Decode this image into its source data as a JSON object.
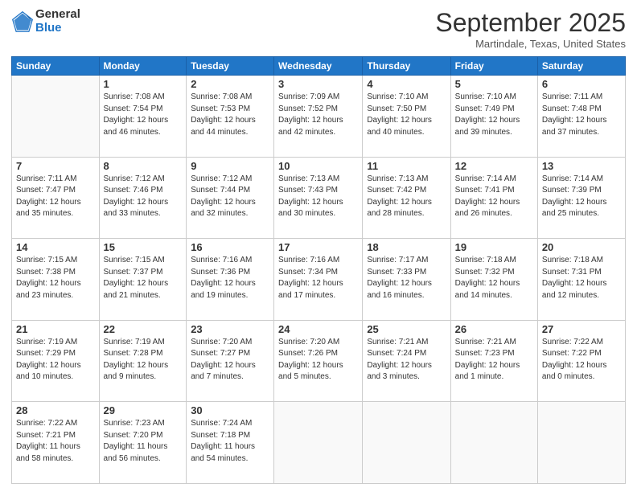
{
  "header": {
    "logo_general": "General",
    "logo_blue": "Blue",
    "title": "September 2025",
    "location": "Martindale, Texas, United States"
  },
  "days_of_week": [
    "Sunday",
    "Monday",
    "Tuesday",
    "Wednesday",
    "Thursday",
    "Friday",
    "Saturday"
  ],
  "weeks": [
    [
      {
        "day": "",
        "sunrise": "",
        "sunset": "",
        "daylight": ""
      },
      {
        "day": "1",
        "sunrise": "7:08 AM",
        "sunset": "7:54 PM",
        "daylight": "12 hours and 46 minutes."
      },
      {
        "day": "2",
        "sunrise": "7:08 AM",
        "sunset": "7:53 PM",
        "daylight": "12 hours and 44 minutes."
      },
      {
        "day": "3",
        "sunrise": "7:09 AM",
        "sunset": "7:52 PM",
        "daylight": "12 hours and 42 minutes."
      },
      {
        "day": "4",
        "sunrise": "7:10 AM",
        "sunset": "7:50 PM",
        "daylight": "12 hours and 40 minutes."
      },
      {
        "day": "5",
        "sunrise": "7:10 AM",
        "sunset": "7:49 PM",
        "daylight": "12 hours and 39 minutes."
      },
      {
        "day": "6",
        "sunrise": "7:11 AM",
        "sunset": "7:48 PM",
        "daylight": "12 hours and 37 minutes."
      }
    ],
    [
      {
        "day": "7",
        "sunrise": "7:11 AM",
        "sunset": "7:47 PM",
        "daylight": "12 hours and 35 minutes."
      },
      {
        "day": "8",
        "sunrise": "7:12 AM",
        "sunset": "7:46 PM",
        "daylight": "12 hours and 33 minutes."
      },
      {
        "day": "9",
        "sunrise": "7:12 AM",
        "sunset": "7:44 PM",
        "daylight": "12 hours and 32 minutes."
      },
      {
        "day": "10",
        "sunrise": "7:13 AM",
        "sunset": "7:43 PM",
        "daylight": "12 hours and 30 minutes."
      },
      {
        "day": "11",
        "sunrise": "7:13 AM",
        "sunset": "7:42 PM",
        "daylight": "12 hours and 28 minutes."
      },
      {
        "day": "12",
        "sunrise": "7:14 AM",
        "sunset": "7:41 PM",
        "daylight": "12 hours and 26 minutes."
      },
      {
        "day": "13",
        "sunrise": "7:14 AM",
        "sunset": "7:39 PM",
        "daylight": "12 hours and 25 minutes."
      }
    ],
    [
      {
        "day": "14",
        "sunrise": "7:15 AM",
        "sunset": "7:38 PM",
        "daylight": "12 hours and 23 minutes."
      },
      {
        "day": "15",
        "sunrise": "7:15 AM",
        "sunset": "7:37 PM",
        "daylight": "12 hours and 21 minutes."
      },
      {
        "day": "16",
        "sunrise": "7:16 AM",
        "sunset": "7:36 PM",
        "daylight": "12 hours and 19 minutes."
      },
      {
        "day": "17",
        "sunrise": "7:16 AM",
        "sunset": "7:34 PM",
        "daylight": "12 hours and 17 minutes."
      },
      {
        "day": "18",
        "sunrise": "7:17 AM",
        "sunset": "7:33 PM",
        "daylight": "12 hours and 16 minutes."
      },
      {
        "day": "19",
        "sunrise": "7:18 AM",
        "sunset": "7:32 PM",
        "daylight": "12 hours and 14 minutes."
      },
      {
        "day": "20",
        "sunrise": "7:18 AM",
        "sunset": "7:31 PM",
        "daylight": "12 hours and 12 minutes."
      }
    ],
    [
      {
        "day": "21",
        "sunrise": "7:19 AM",
        "sunset": "7:29 PM",
        "daylight": "12 hours and 10 minutes."
      },
      {
        "day": "22",
        "sunrise": "7:19 AM",
        "sunset": "7:28 PM",
        "daylight": "12 hours and 9 minutes."
      },
      {
        "day": "23",
        "sunrise": "7:20 AM",
        "sunset": "7:27 PM",
        "daylight": "12 hours and 7 minutes."
      },
      {
        "day": "24",
        "sunrise": "7:20 AM",
        "sunset": "7:26 PM",
        "daylight": "12 hours and 5 minutes."
      },
      {
        "day": "25",
        "sunrise": "7:21 AM",
        "sunset": "7:24 PM",
        "daylight": "12 hours and 3 minutes."
      },
      {
        "day": "26",
        "sunrise": "7:21 AM",
        "sunset": "7:23 PM",
        "daylight": "12 hours and 1 minute."
      },
      {
        "day": "27",
        "sunrise": "7:22 AM",
        "sunset": "7:22 PM",
        "daylight": "12 hours and 0 minutes."
      }
    ],
    [
      {
        "day": "28",
        "sunrise": "7:22 AM",
        "sunset": "7:21 PM",
        "daylight": "11 hours and 58 minutes."
      },
      {
        "day": "29",
        "sunrise": "7:23 AM",
        "sunset": "7:20 PM",
        "daylight": "11 hours and 56 minutes."
      },
      {
        "day": "30",
        "sunrise": "7:24 AM",
        "sunset": "7:18 PM",
        "daylight": "11 hours and 54 minutes."
      },
      {
        "day": "",
        "sunrise": "",
        "sunset": "",
        "daylight": ""
      },
      {
        "day": "",
        "sunrise": "",
        "sunset": "",
        "daylight": ""
      },
      {
        "day": "",
        "sunrise": "",
        "sunset": "",
        "daylight": ""
      },
      {
        "day": "",
        "sunrise": "",
        "sunset": "",
        "daylight": ""
      }
    ]
  ]
}
